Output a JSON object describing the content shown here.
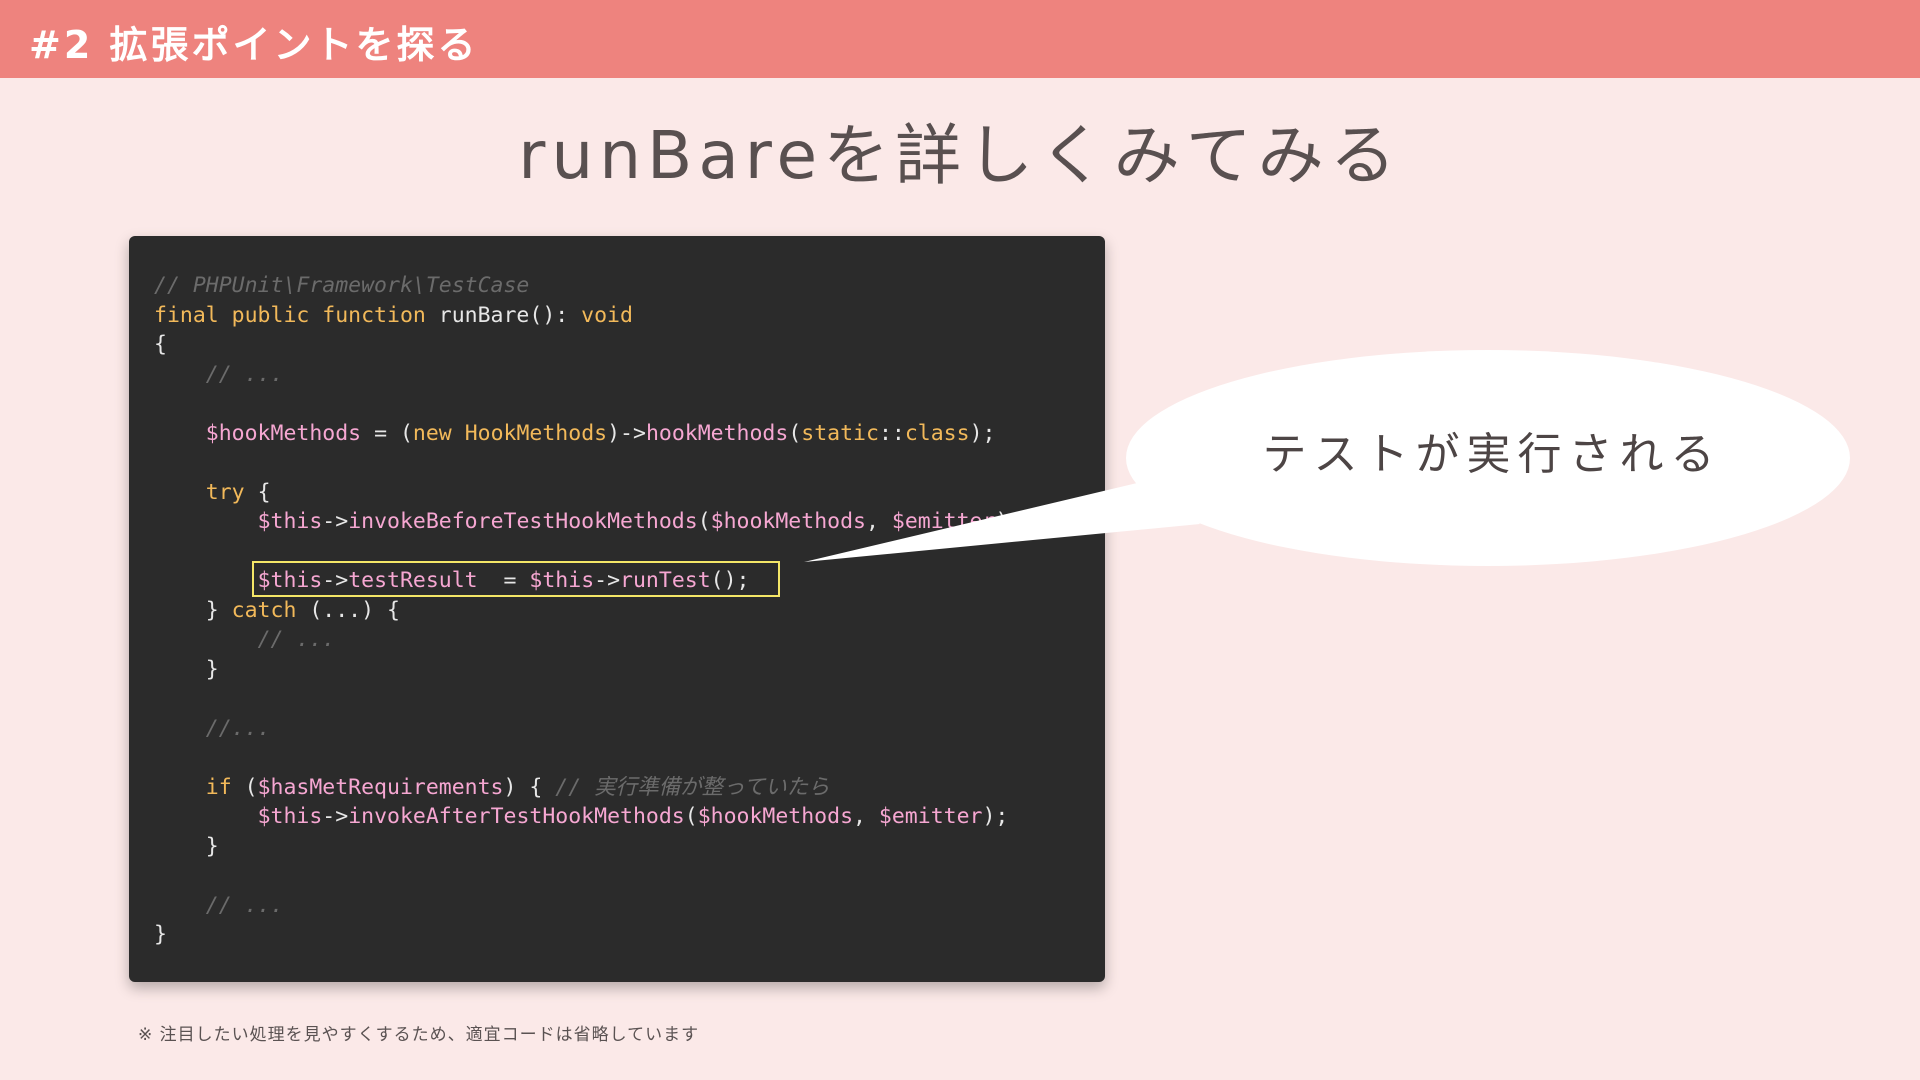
{
  "header": {
    "title": "#2 拡張ポイントを探る"
  },
  "slide": {
    "title": "runBareを詳しくみてみる"
  },
  "code": {
    "lines": [
      [
        {
          "t": "// PHPUnit\\Framework\\TestCase",
          "c": "comment"
        }
      ],
      [
        {
          "t": "final public function",
          "c": "kw"
        },
        {
          "t": " runBare(): ",
          "c": "plain"
        },
        {
          "t": "void",
          "c": "kw"
        }
      ],
      [
        {
          "t": "{",
          "c": "plain"
        }
      ],
      [
        {
          "t": "    ",
          "c": "plain"
        },
        {
          "t": "// ...",
          "c": "comment"
        }
      ],
      [],
      [
        {
          "t": "    ",
          "c": "plain"
        },
        {
          "t": "$hookMethods",
          "c": "var"
        },
        {
          "t": " = (",
          "c": "plain"
        },
        {
          "t": "new",
          "c": "kw"
        },
        {
          "t": " ",
          "c": "plain"
        },
        {
          "t": "HookMethods",
          "c": "cls"
        },
        {
          "t": ")->",
          "c": "plain"
        },
        {
          "t": "hookMethods",
          "c": "fn"
        },
        {
          "t": "(",
          "c": "plain"
        },
        {
          "t": "static",
          "c": "kw"
        },
        {
          "t": "::",
          "c": "plain"
        },
        {
          "t": "class",
          "c": "kw"
        },
        {
          "t": ");",
          "c": "plain"
        }
      ],
      [],
      [
        {
          "t": "    ",
          "c": "plain"
        },
        {
          "t": "try",
          "c": "kw"
        },
        {
          "t": " {",
          "c": "plain"
        }
      ],
      [
        {
          "t": "        ",
          "c": "plain"
        },
        {
          "t": "$this",
          "c": "var"
        },
        {
          "t": "->",
          "c": "plain"
        },
        {
          "t": "invokeBeforeTestHookMethods",
          "c": "fn"
        },
        {
          "t": "(",
          "c": "plain"
        },
        {
          "t": "$hookMethods",
          "c": "var"
        },
        {
          "t": ", ",
          "c": "plain"
        },
        {
          "t": "$emitter",
          "c": "var"
        },
        {
          "t": ");",
          "c": "plain"
        }
      ],
      [],
      [
        {
          "t": "        ",
          "c": "plain"
        },
        {
          "t": "$this",
          "c": "var"
        },
        {
          "t": "->",
          "c": "plain"
        },
        {
          "t": "testResult",
          "c": "fn"
        },
        {
          "t": "  = ",
          "c": "plain"
        },
        {
          "t": "$this",
          "c": "var"
        },
        {
          "t": "->",
          "c": "plain"
        },
        {
          "t": "runTest",
          "c": "fn"
        },
        {
          "t": "();",
          "c": "plain"
        }
      ],
      [
        {
          "t": "    } ",
          "c": "plain"
        },
        {
          "t": "catch",
          "c": "kw"
        },
        {
          "t": " (...) {",
          "c": "plain"
        }
      ],
      [
        {
          "t": "        ",
          "c": "plain"
        },
        {
          "t": "// ...",
          "c": "comment"
        }
      ],
      [
        {
          "t": "    }",
          "c": "plain"
        }
      ],
      [],
      [
        {
          "t": "    ",
          "c": "plain"
        },
        {
          "t": "//...",
          "c": "comment"
        }
      ],
      [],
      [
        {
          "t": "    ",
          "c": "plain"
        },
        {
          "t": "if",
          "c": "kw"
        },
        {
          "t": " (",
          "c": "plain"
        },
        {
          "t": "$hasMetRequirements",
          "c": "var"
        },
        {
          "t": ") { ",
          "c": "plain"
        },
        {
          "t": "// ",
          "c": "comment"
        },
        {
          "t": "実行準備が整っていたら",
          "c": "jp"
        }
      ],
      [
        {
          "t": "        ",
          "c": "plain"
        },
        {
          "t": "$this",
          "c": "var"
        },
        {
          "t": "->",
          "c": "plain"
        },
        {
          "t": "invokeAfterTestHookMethods",
          "c": "fn"
        },
        {
          "t": "(",
          "c": "plain"
        },
        {
          "t": "$hookMethods",
          "c": "var"
        },
        {
          "t": ", ",
          "c": "plain"
        },
        {
          "t": "$emitter",
          "c": "var"
        },
        {
          "t": ");",
          "c": "plain"
        }
      ],
      [
        {
          "t": "    }",
          "c": "plain"
        }
      ],
      [],
      [
        {
          "t": "    ",
          "c": "plain"
        },
        {
          "t": "// ...",
          "c": "comment"
        }
      ],
      [
        {
          "t": "}",
          "c": "plain"
        }
      ]
    ]
  },
  "callout": {
    "text": "テストが実行される"
  },
  "footnote": {
    "text": "※ 注目したい処理を見やすくするため、適宜コードは省略しています"
  },
  "colors": {
    "background": "#fbe9e8",
    "header": "#ee837e",
    "code_bg": "#2b2b2b",
    "keyword": "#f2b95a",
    "variable": "#f6a7d2",
    "comment": "#6b6b6b",
    "highlight": "#f4e667"
  }
}
